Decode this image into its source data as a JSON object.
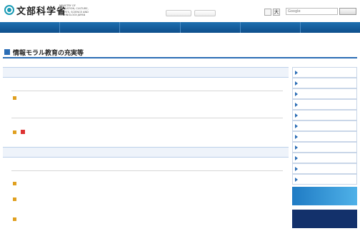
{
  "header": {
    "logo_text": "文部科学省",
    "logo_sub": "MINISTRY OF EDUCATION, CULTURE, SPORTS, SCIENCE AND TECHNOLOGY-JAPAN",
    "util_links": "",
    "btn1": "",
    "btn2": "",
    "font_size_label": "",
    "font_small": "",
    "font_large": "大",
    "search_placeholder": "Google",
    "search_button": ""
  },
  "gnav": {
    "items": [
      "",
      "",
      "",
      "",
      "",
      ""
    ]
  },
  "breadcrumb": "",
  "page": {
    "title": "情報モラル教育の充実等"
  },
  "main": {
    "section1": {
      "heading": "",
      "sub1": "",
      "sub1_link": "",
      "sub2": "",
      "sub2_note": "",
      "sub2_link": "",
      "sub2_link_suffix": ""
    },
    "section2": {
      "heading": "",
      "sub1": "",
      "note1": "",
      "link1": "",
      "note2": "",
      "link2": "",
      "note3": "",
      "link3": ""
    }
  },
  "sidebar": {
    "items": [
      "",
      "",
      "",
      "",
      "",
      "",
      "",
      "",
      "",
      "",
      ""
    ],
    "banner1_title": "",
    "banner1_sub": "",
    "banner2_title": "",
    "banner2_sub": ""
  },
  "colors": {
    "nav_bg": "#1d6fb0",
    "accent": "#2b6db5",
    "link": "#1a55a8",
    "bullet": "#e0a020",
    "pdf": "#dd3333"
  }
}
